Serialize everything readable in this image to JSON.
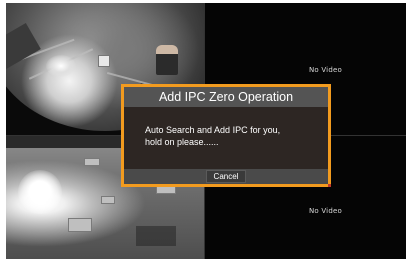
{
  "grid": {
    "channels": [
      {
        "status": ""
      },
      {
        "status": "No Video"
      },
      {
        "status": ""
      },
      {
        "status": "No Video"
      }
    ]
  },
  "dialog": {
    "title": "Add IPC Zero Operation",
    "message_line1": "Auto Search and Add IPC for you,",
    "message_line2": "hold on please......",
    "cancel_label": "Cancel"
  },
  "colors": {
    "dialog_border": "#f29b1f",
    "title_bar": "#545454",
    "body": "#2d2623",
    "footer": "#4a4a4a"
  }
}
